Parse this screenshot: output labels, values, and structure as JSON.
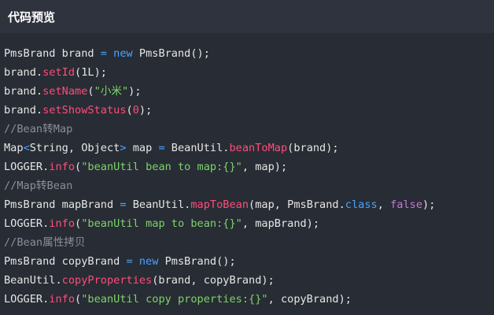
{
  "header": {
    "title": "代码预览"
  },
  "code": {
    "lines": [
      [
        {
          "t": "PmsBrand brand ",
          "c": "plain"
        },
        {
          "t": "=",
          "c": "op"
        },
        {
          "t": " ",
          "c": "plain"
        },
        {
          "t": "new",
          "c": "kw"
        },
        {
          "t": " PmsBrand();",
          "c": "plain"
        }
      ],
      [
        {
          "t": "brand.",
          "c": "plain"
        },
        {
          "t": "setId",
          "c": "method"
        },
        {
          "t": "(",
          "c": "plain"
        },
        {
          "t": "1L",
          "c": "plain"
        },
        {
          "t": ");",
          "c": "plain"
        }
      ],
      [
        {
          "t": "brand.",
          "c": "plain"
        },
        {
          "t": "setName",
          "c": "method"
        },
        {
          "t": "(",
          "c": "plain"
        },
        {
          "t": "\"小米\"",
          "c": "string"
        },
        {
          "t": ");",
          "c": "plain"
        }
      ],
      [
        {
          "t": "brand.",
          "c": "plain"
        },
        {
          "t": "setShowStatus",
          "c": "method"
        },
        {
          "t": "(",
          "c": "plain"
        },
        {
          "t": "0",
          "c": "number"
        },
        {
          "t": ");",
          "c": "plain"
        }
      ],
      [
        {
          "t": "//Bean转Map",
          "c": "comment"
        }
      ],
      [
        {
          "t": "Map",
          "c": "plain"
        },
        {
          "t": "<",
          "c": "op"
        },
        {
          "t": "String, Object",
          "c": "plain"
        },
        {
          "t": ">",
          "c": "op"
        },
        {
          "t": " map ",
          "c": "plain"
        },
        {
          "t": "=",
          "c": "op"
        },
        {
          "t": " BeanUtil.",
          "c": "plain"
        },
        {
          "t": "beanToMap",
          "c": "method"
        },
        {
          "t": "(brand);",
          "c": "plain"
        }
      ],
      [
        {
          "t": "LOGGER.",
          "c": "plain"
        },
        {
          "t": "info",
          "c": "method"
        },
        {
          "t": "(",
          "c": "plain"
        },
        {
          "t": "\"beanUtil bean to map:{}\"",
          "c": "string"
        },
        {
          "t": ", map);",
          "c": "plain"
        }
      ],
      [
        {
          "t": "//Map转Bean",
          "c": "comment"
        }
      ],
      [
        {
          "t": "PmsBrand mapBrand ",
          "c": "plain"
        },
        {
          "t": "=",
          "c": "op"
        },
        {
          "t": " BeanUtil.",
          "c": "plain"
        },
        {
          "t": "mapToBean",
          "c": "method"
        },
        {
          "t": "(map, PmsBrand.",
          "c": "plain"
        },
        {
          "t": "class",
          "c": "class"
        },
        {
          "t": ", ",
          "c": "plain"
        },
        {
          "t": "false",
          "c": "bool"
        },
        {
          "t": ");",
          "c": "plain"
        }
      ],
      [
        {
          "t": "LOGGER.",
          "c": "plain"
        },
        {
          "t": "info",
          "c": "method"
        },
        {
          "t": "(",
          "c": "plain"
        },
        {
          "t": "\"beanUtil map to bean:{}\"",
          "c": "string"
        },
        {
          "t": ", mapBrand);",
          "c": "plain"
        }
      ],
      [
        {
          "t": "//Bean属性拷贝",
          "c": "comment"
        }
      ],
      [
        {
          "t": "PmsBrand copyBrand ",
          "c": "plain"
        },
        {
          "t": "=",
          "c": "op"
        },
        {
          "t": " ",
          "c": "plain"
        },
        {
          "t": "new",
          "c": "kw"
        },
        {
          "t": " PmsBrand();",
          "c": "plain"
        }
      ],
      [
        {
          "t": "BeanUtil.",
          "c": "plain"
        },
        {
          "t": "copyProperties",
          "c": "method"
        },
        {
          "t": "(brand, copyBrand);",
          "c": "plain"
        }
      ],
      [
        {
          "t": "LOGGER.",
          "c": "plain"
        },
        {
          "t": "info",
          "c": "method"
        },
        {
          "t": "(",
          "c": "plain"
        },
        {
          "t": "\"beanUtil copy properties:{}\"",
          "c": "string"
        },
        {
          "t": ", copyBrand);",
          "c": "plain"
        }
      ]
    ]
  }
}
